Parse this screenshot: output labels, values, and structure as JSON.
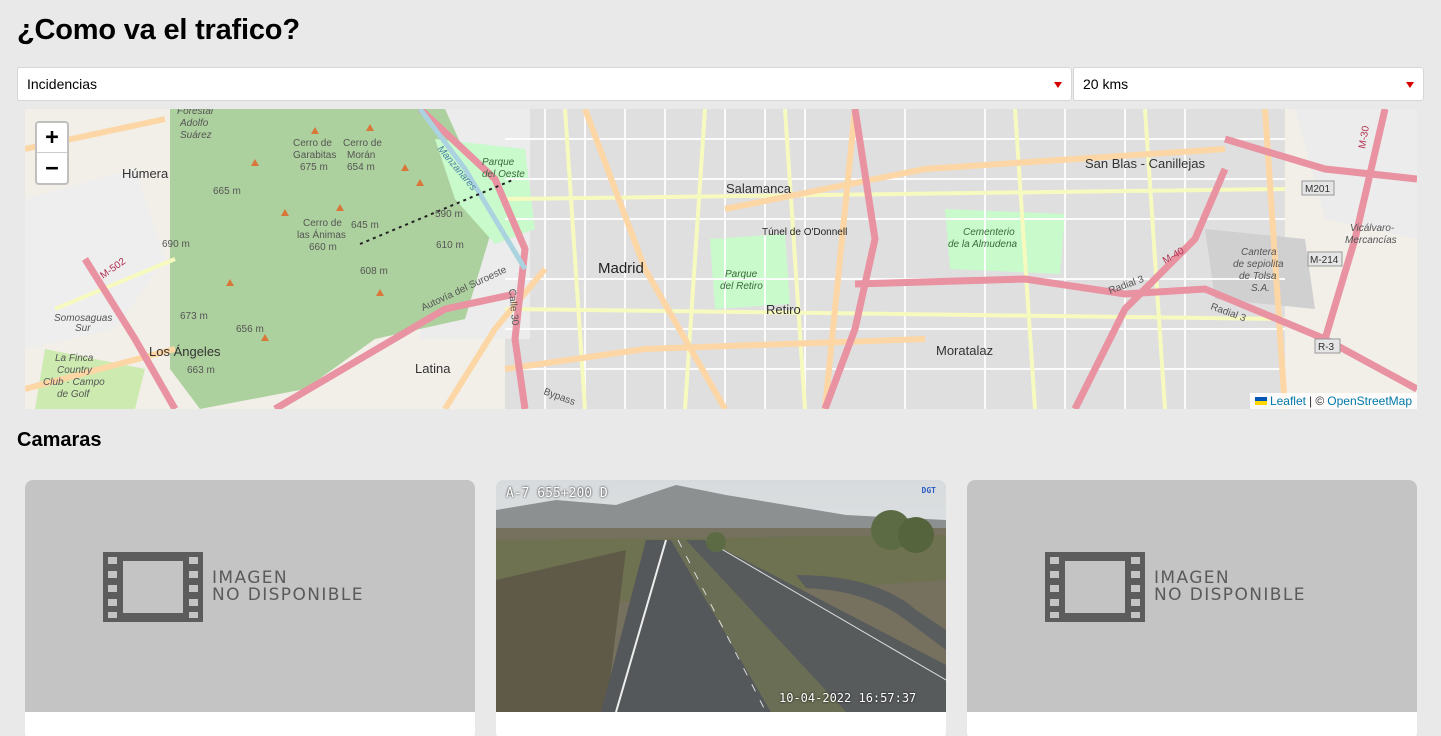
{
  "page": {
    "title": "¿Como va el trafico?"
  },
  "filters": {
    "type": {
      "value": "Incidencias"
    },
    "radius": {
      "value": "20 kms"
    }
  },
  "map": {
    "zoom_in": "+",
    "zoom_out": "−",
    "attribution": {
      "leaflet": "Leaflet",
      "separator": "| ©",
      "osm": "OpenStreetMap"
    },
    "labels": {
      "madrid": "Madrid",
      "salamanca": "Salamanca",
      "retiro": "Retiro",
      "moratalaz": "Moratalaz",
      "latina": "Latina",
      "humera": "Húmera",
      "los_angeles": "Los Ángeles",
      "san_blas": "San Blas - Canillejas",
      "tunel": "Túnel de O'Donnell",
      "parque_retiro_1": "Parque",
      "parque_retiro_2": "del Retiro",
      "cementerio_1": "Cementerio",
      "cementerio_2": "de la Almudena",
      "parque_oeste_1": "Parque",
      "parque_oeste_2": "del Oeste",
      "cerro_garabitas_1": "Cerro de",
      "cerro_garabitas_2": "Garabitas",
      "cerro_garabitas_3": "675 m",
      "cerro_moran_1": "Cerro de",
      "cerro_moran_2": "Morán",
      "cerro_moran_3": "654 m",
      "cerro_animas_1": "Cerro de",
      "cerro_animas_2": "las Ánimas",
      "cerro_animas_3": "660 m",
      "m665": "665 m",
      "m690": "690 m",
      "m645": "645 m",
      "m590": "590 m",
      "m610": "610 m",
      "m608": "608 m",
      "m673": "673 m",
      "m656": "656 m",
      "m663": "663 m",
      "autovia": "Autovía del Suroeste",
      "radial3a": "Radial 3",
      "radial3b": "Radial 3",
      "m201": "M201",
      "m214": "M-214",
      "r3": "R-3",
      "m30": "M-30",
      "m40": "M-40",
      "m502": "M-502",
      "somosaguas_1": "Somosaguas",
      "somosaguas_2": "Sur",
      "lafinca_1": "La Finca",
      "lafinca_2": "Country",
      "lafinca_3": "Club · Campo",
      "lafinca_4": "de Golf",
      "forestal_1": "Forestal",
      "forestal_2": "Adolfo",
      "forestal_3": "Suárez",
      "cantera_1": "Cantera",
      "cantera_2": "de sepiolita",
      "cantera_3": "de Tolsa",
      "cantera_4": "S.A.",
      "vicalvaro_1": "Vicálvaro-",
      "vicalvaro_2": "Mercancías",
      "manzanares": "Manzanares",
      "calle30": "Calle 30",
      "bypass": "Bypass"
    }
  },
  "cameras": {
    "title": "Camaras",
    "no_image_line1": "IMAGEN",
    "no_image_line2": "NO DISPONIBLE",
    "items": [
      {
        "status": "no-image",
        "caption": ""
      },
      {
        "status": "image",
        "road_code": "A-7 655+200 D",
        "timestamp": "10-04-2022 16:57:37",
        "logo": "DGT",
        "caption": ""
      },
      {
        "status": "no-image",
        "caption": ""
      }
    ]
  },
  "colors": {
    "caret": "#d40000",
    "link": "#0078a8",
    "placeholder": "#c4c4c4"
  }
}
